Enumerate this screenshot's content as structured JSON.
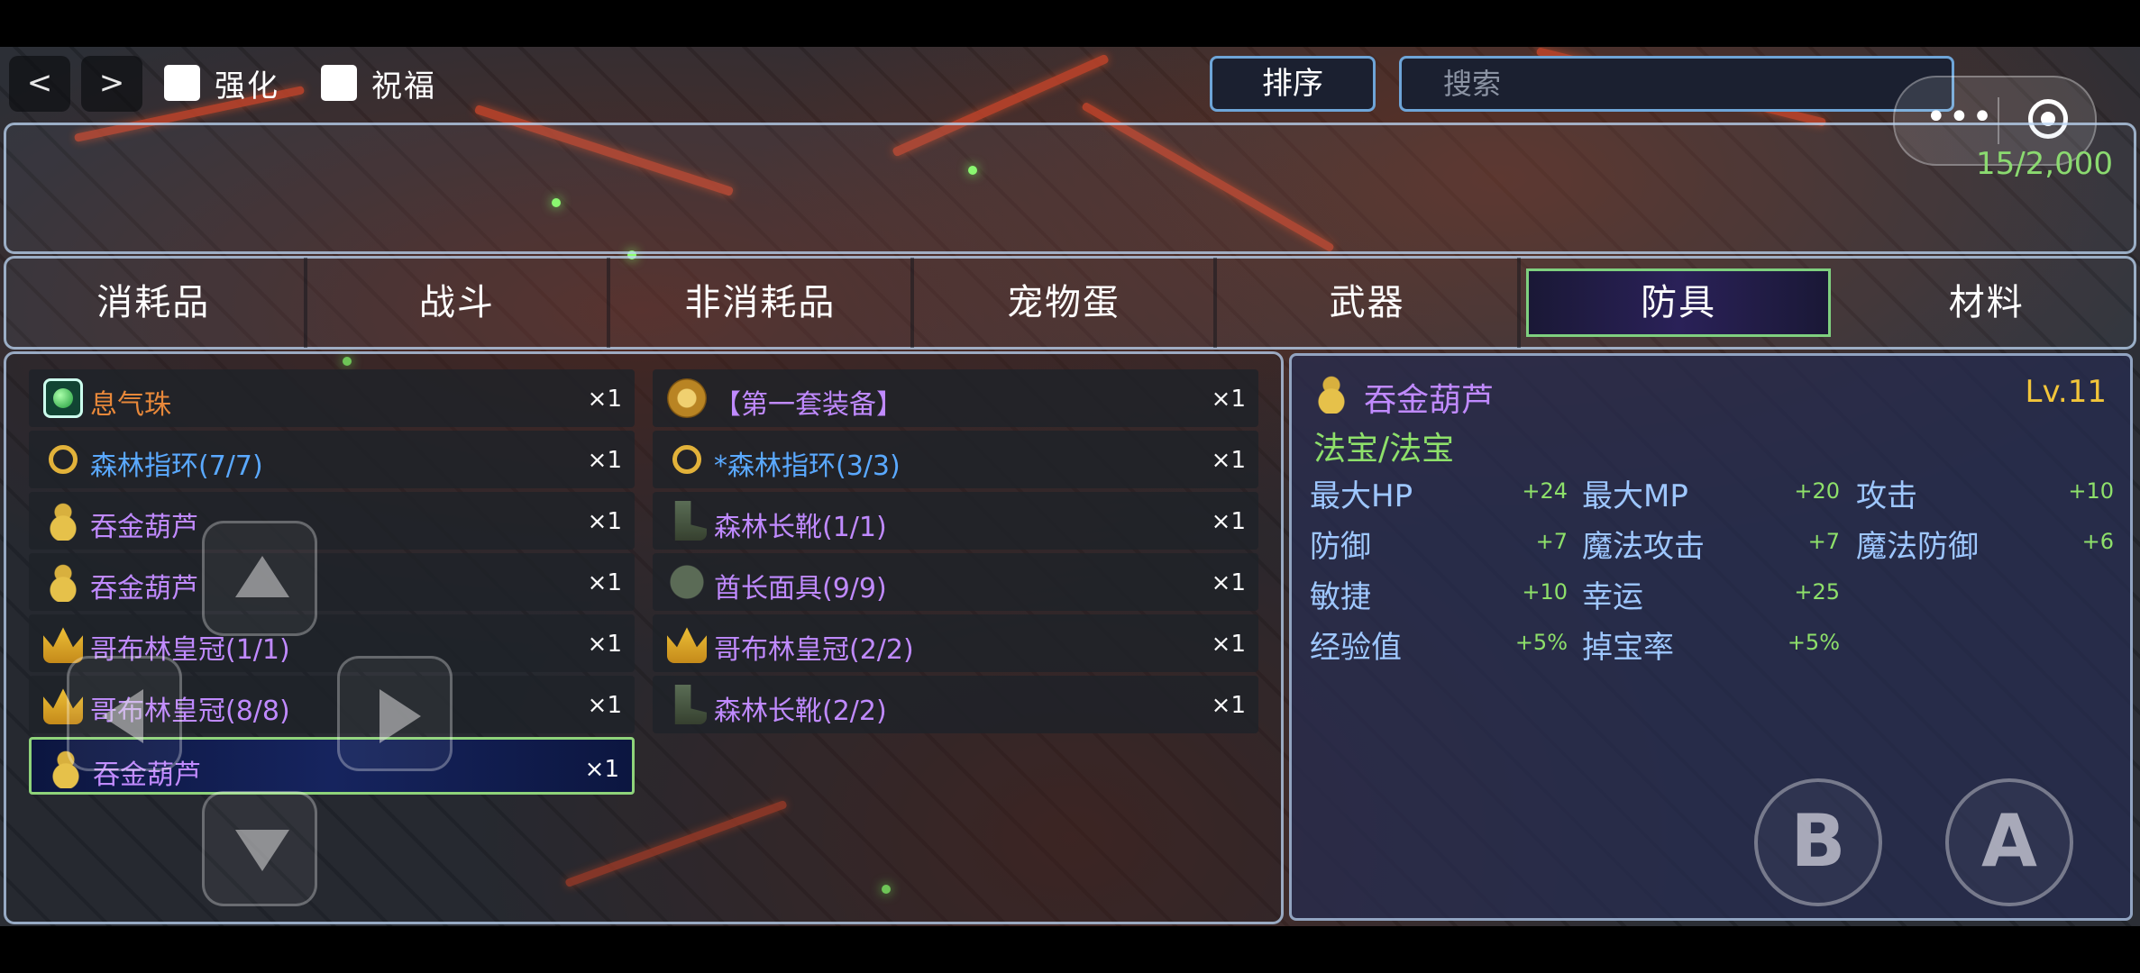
{
  "topbar": {
    "prev_label": "<",
    "next_label": ">",
    "checkbox_enhance": "强化",
    "checkbox_bless": "祝福",
    "sort_label": "排序",
    "search_placeholder": "搜索",
    "capsule_more_icon": "more-dots-icon",
    "capsule_close_icon": "target-icon"
  },
  "inventory_count": "15/2,000",
  "tabs": [
    {
      "label": "消耗品",
      "active": false
    },
    {
      "label": "战斗",
      "active": false
    },
    {
      "label": "非消耗品",
      "active": false
    },
    {
      "label": "宠物蛋",
      "active": false
    },
    {
      "label": "武器",
      "active": false
    },
    {
      "label": "防具",
      "active": true
    },
    {
      "label": "材料",
      "active": false
    }
  ],
  "items_left": [
    {
      "name": "息气珠",
      "qty": "×1",
      "color": "#e8883a",
      "icon": "green-orb-icon"
    },
    {
      "name": "森林指环(7/7)",
      "qty": "×1",
      "color": "#5aa9ff",
      "icon": "ring-icon"
    },
    {
      "name": "吞金葫芦",
      "qty": "×1",
      "color": "#c08aff",
      "icon": "gourd-icon"
    },
    {
      "name": "吞金葫芦",
      "qty": "×1",
      "color": "#c08aff",
      "icon": "gourd-icon"
    },
    {
      "name": "哥布林皇冠(1/1)",
      "qty": "×1",
      "color": "#c08aff",
      "icon": "crown-icon"
    },
    {
      "name": "哥布林皇冠(8/8)",
      "qty": "×1",
      "color": "#c08aff",
      "icon": "crown-icon"
    },
    {
      "name": "吞金葫芦",
      "qty": "×1",
      "color": "#c08aff",
      "icon": "gourd-icon",
      "selected": true
    }
  ],
  "items_right": [
    {
      "name": "【第一套装备】",
      "qty": "×1",
      "color": "#c08aff",
      "icon": "coin-icon"
    },
    {
      "name": "*森林指环(3/3)",
      "qty": "×1",
      "color": "#5aa9ff",
      "icon": "ring-icon"
    },
    {
      "name": "森林长靴(1/1)",
      "qty": "×1",
      "color": "#c08aff",
      "icon": "boot-icon"
    },
    {
      "name": "酋长面具(9/9)",
      "qty": "×1",
      "color": "#c08aff",
      "icon": "mask-icon"
    },
    {
      "name": "哥布林皇冠(2/2)",
      "qty": "×1",
      "color": "#c08aff",
      "icon": "crown-icon"
    },
    {
      "name": "森林长靴(2/2)",
      "qty": "×1",
      "color": "#c08aff",
      "icon": "boot-icon"
    }
  ],
  "detail": {
    "name": "吞金葫芦",
    "level": "Lv.11",
    "type": "法宝/法宝",
    "stats": [
      {
        "label": "最大HP",
        "value": "+24"
      },
      {
        "label": "最大MP",
        "value": "+20"
      },
      {
        "label": "攻击",
        "value": "+10"
      },
      {
        "label": "防御",
        "value": "+7"
      },
      {
        "label": "魔法攻击",
        "value": "+7"
      },
      {
        "label": "魔法防御",
        "value": "+6"
      },
      {
        "label": "敏捷",
        "value": "+10"
      },
      {
        "label": "幸运",
        "value": "+25"
      },
      {
        "label": "经验值",
        "value": "+5%"
      },
      {
        "label": "掉宝率",
        "value": "+5%"
      }
    ]
  },
  "controls": {
    "b_label": "B",
    "a_label": "A"
  },
  "colors": {
    "accent_border": "#6ea5d8",
    "stat_value": "#8ee06a",
    "level": "#f2c53a",
    "epic_name": "#c08aff",
    "rare_name": "#5aa9ff"
  }
}
